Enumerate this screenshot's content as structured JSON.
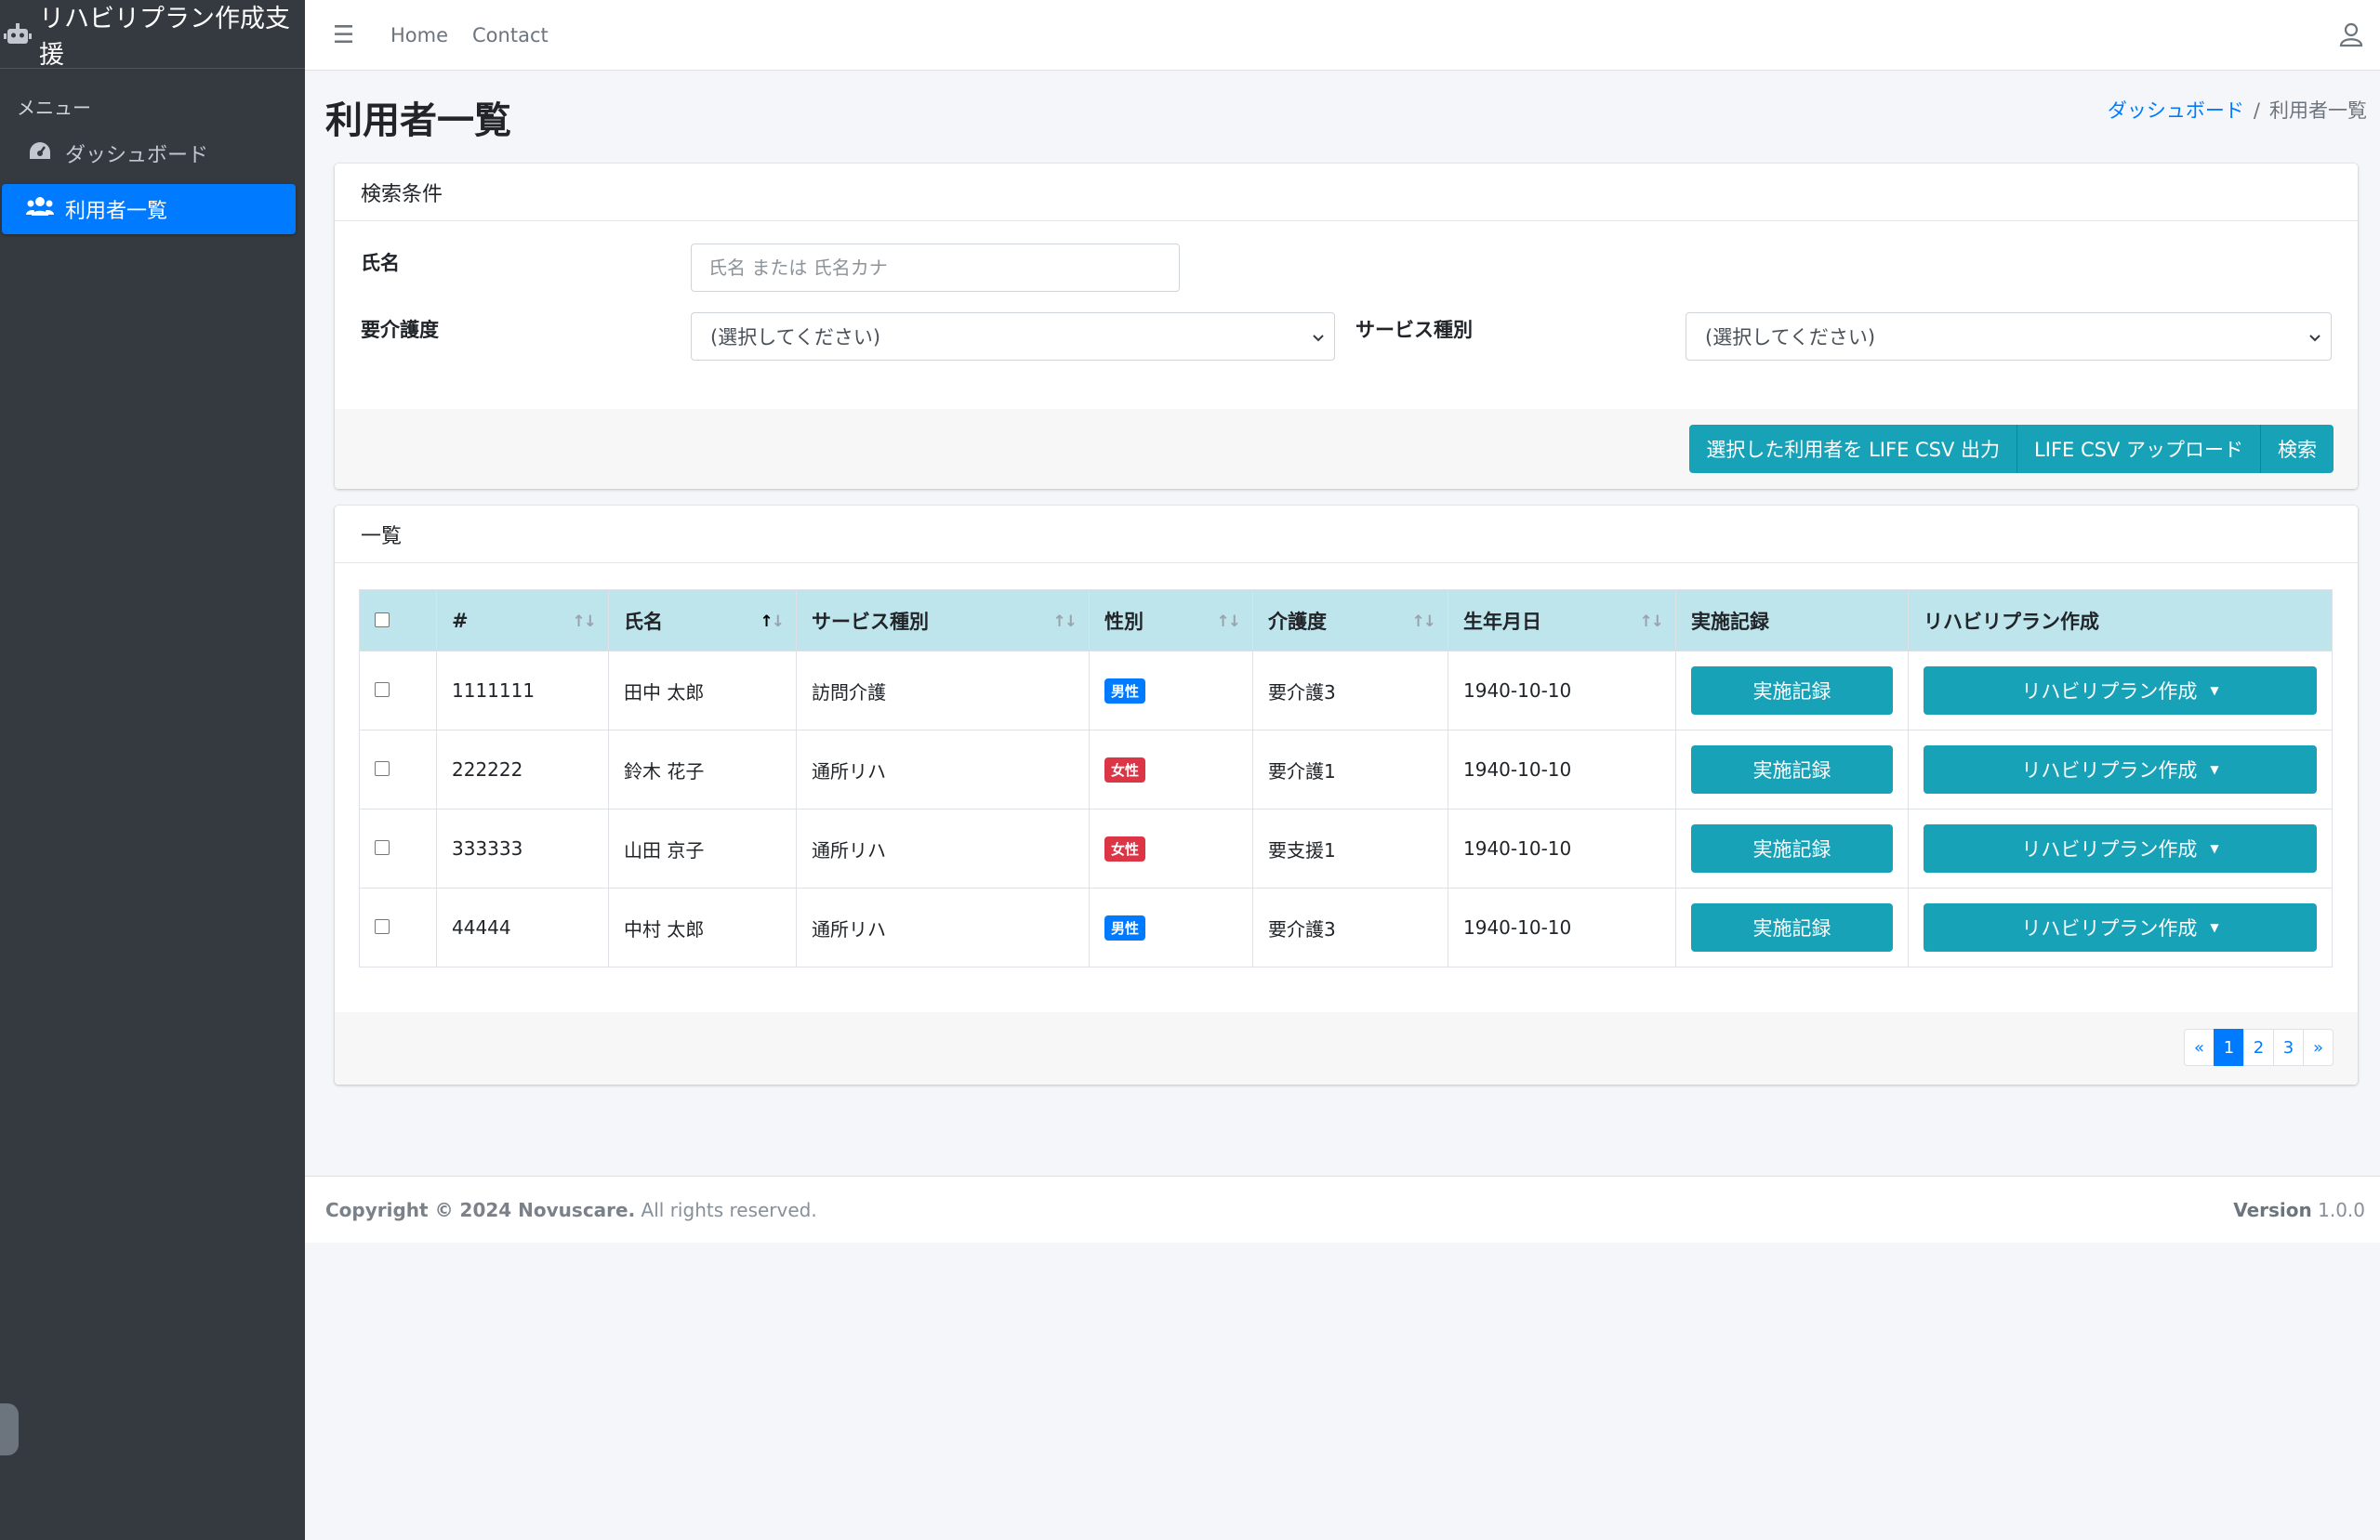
{
  "app": {
    "title": "リハビリプラン作成支援"
  },
  "sidebar": {
    "header": "メニュー",
    "items": [
      {
        "label": "ダッシュボード",
        "icon": "tachometer-icon",
        "active": false
      },
      {
        "label": "利用者一覧",
        "icon": "users-icon",
        "active": true
      }
    ]
  },
  "navbar": {
    "links": [
      "Home",
      "Contact"
    ]
  },
  "page": {
    "title": "利用者一覧"
  },
  "breadcrumb": {
    "home": "ダッシュボード",
    "separator": "/",
    "current": "利用者一覧"
  },
  "search": {
    "header": "検索条件",
    "name_label": "氏名",
    "name_placeholder": "氏名 または 氏名カナ",
    "care_label": "要介護度",
    "care_value": "(選択してください)",
    "service_label": "サービス種別",
    "service_value": "(選択してください)",
    "buttons": [
      "選択した利用者を LIFE CSV 出力",
      "LIFE CSV アップロード",
      "検索"
    ]
  },
  "list": {
    "header": "一覧",
    "columns": [
      "#",
      "氏名",
      "サービス種別",
      "性別",
      "介護度",
      "生年月日",
      "実施記録",
      "リハビリプラン作成"
    ],
    "record_button": "実施記録",
    "plan_button": "リハビリプラン作成",
    "rows": [
      {
        "id": "1111111",
        "name": "田中 太郎",
        "service": "訪問介護",
        "gender": "男性",
        "care": "要介護3",
        "birth": "1940-10-10"
      },
      {
        "id": "222222",
        "name": "鈴木 花子",
        "service": "通所リハ",
        "gender": "女性",
        "care": "要介護1",
        "birth": "1940-10-10"
      },
      {
        "id": "333333",
        "name": "山田 京子",
        "service": "通所リハ",
        "gender": "女性",
        "care": "要支援1",
        "birth": "1940-10-10"
      },
      {
        "id": "44444",
        "name": "中村 太郎",
        "service": "通所リハ",
        "gender": "男性",
        "care": "要介護3",
        "birth": "1940-10-10"
      }
    ]
  },
  "pagination": {
    "prev": "«",
    "pages": [
      "1",
      "2",
      "3"
    ],
    "next": "»",
    "current": "1"
  },
  "footer": {
    "copyright_bold": "Copyright © 2024 Novuscare.",
    "copyright_rest": " All rights reserved.",
    "version_label": "Version",
    "version_value": " 1.0.0"
  },
  "colors": {
    "primary": "#007bff",
    "info": "#17a2b8",
    "sidebar": "#343a40",
    "table_header": "#bee5eb",
    "danger": "#dc3545"
  }
}
